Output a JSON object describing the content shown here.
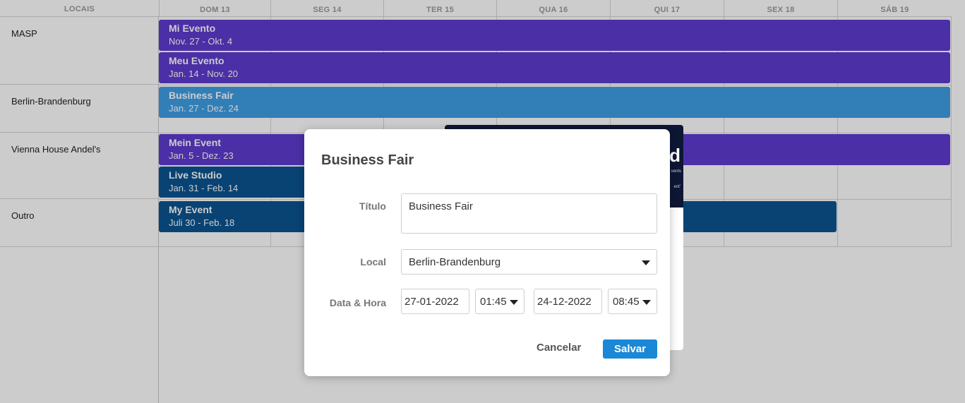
{
  "header": {
    "locations_label": "LOCAIS",
    "days": [
      "DOM 13",
      "SEG 14",
      "TER 15",
      "QUA 16",
      "QUI 17",
      "SEX 18",
      "SÁB 19"
    ]
  },
  "resources": [
    "MASP",
    "Berlin-Brandenburg",
    "Vienna House Andel's",
    "Outro"
  ],
  "events": [
    {
      "title": "Mi Evento",
      "dates": "Nov. 27 - Okt. 4",
      "color": "#5e3bd0"
    },
    {
      "title": "Meu Evento",
      "dates": "Jan. 14 - Nov. 20",
      "color": "#5e3bd0"
    },
    {
      "title": "Business Fair",
      "dates": "Jan. 27 - Dez. 24",
      "color": "#3f9fe6"
    },
    {
      "title": "Mein Event",
      "dates": "Jan. 5 - Dez. 23",
      "color": "#5e3bd0"
    },
    {
      "title": "Live Studio",
      "dates": "Jan. 31 - Feb. 14",
      "color": "#0b5491"
    },
    {
      "title": "My Event",
      "dates": "Juli 30 - Feb. 18",
      "color": "#0b5491"
    }
  ],
  "background_card": {
    "letter": "d",
    "line1": "vents",
    "line2": "ent'"
  },
  "dialog": {
    "title": "Business Fair",
    "titulo_label": "Título",
    "titulo_value": "Business Fair",
    "local_label": "Local",
    "local_value": "Berlin-Brandenburg",
    "datetime_label": "Data & Hora",
    "start_date": "27-01-2022",
    "start_time": "01:45",
    "end_date": "24-12-2022",
    "end_time": "08:45",
    "cancel_label": "Cancelar",
    "save_label": "Salvar"
  }
}
